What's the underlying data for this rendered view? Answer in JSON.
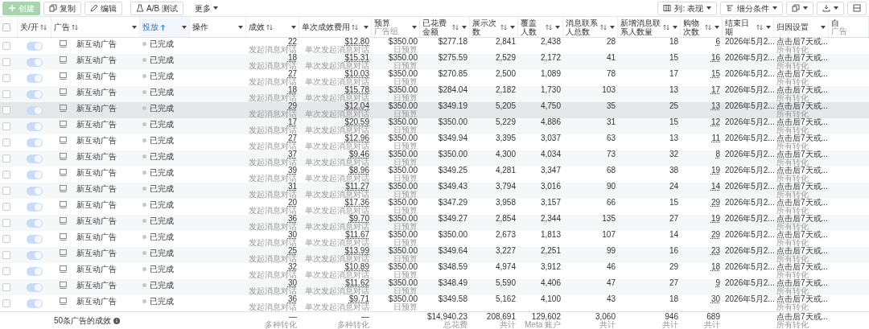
{
  "toolbar": {
    "left": [
      {
        "kind": "create",
        "label": "创建",
        "disabled": true
      },
      {
        "kind": "copy",
        "label": "复制"
      },
      {
        "kind": "edit",
        "label": "编辑"
      },
      {
        "kind": "ab",
        "label": "A/B 测试"
      },
      {
        "kind": "more",
        "label": "更多"
      }
    ],
    "right": [
      {
        "kind": "columns",
        "label": "列: 表现"
      },
      {
        "kind": "breakdown",
        "label": "细分条件"
      },
      {
        "kind": "copy"
      },
      {
        "kind": "export"
      },
      {
        "kind": "report"
      }
    ]
  },
  "select_all": {
    "checked": false
  },
  "columns": [
    {
      "label": "关/开",
      "sortable": true,
      "sorted": false,
      "dropdown": false
    },
    {
      "label": "广告",
      "sortable": true,
      "sorted": false,
      "dropdown": true
    },
    {
      "label": "投放",
      "sortable": true,
      "sorted": true,
      "dropdown": true
    },
    {
      "label": "操作",
      "sortable": false,
      "sorted": false,
      "dropdown": true
    },
    {
      "label": "成效",
      "sortable": true,
      "sorted": false,
      "dropdown": true
    },
    {
      "label": "单次成效费用",
      "sortable": true,
      "sorted": false,
      "dropdown": true
    },
    {
      "label": "预算",
      "sub": "广告组",
      "sortable": false,
      "sorted": false,
      "dropdown": true
    },
    {
      "label": "已花费金额",
      "sortable": true,
      "sorted": false,
      "dropdown": true
    },
    {
      "label": "展示次数",
      "sortable": true,
      "sorted": false,
      "dropdown": true
    },
    {
      "label": "覆盖人数",
      "sortable": true,
      "sorted": false,
      "dropdown": true
    },
    {
      "label": "消息联系人总数",
      "sortable": true,
      "sorted": false,
      "dropdown": true
    },
    {
      "label": "新增消息联系人数量",
      "sortable": true,
      "sorted": false,
      "dropdown": true
    },
    {
      "label": "购物次数",
      "sortable": true,
      "sorted": false,
      "dropdown": true
    },
    {
      "label": "结束日期",
      "sortable": true,
      "sorted": false,
      "dropdown": true
    },
    {
      "label": "归因设置",
      "sortable": false,
      "sorted": false,
      "dropdown": true
    },
    {
      "label": "自",
      "sub": "广告",
      "sortable": false,
      "sorted": false,
      "dropdown": false
    }
  ],
  "rows": [
    {
      "on": true,
      "highlighted": false,
      "name": "新互动广告",
      "status": "已完成",
      "results": "22",
      "results_note": "发起消息对话",
      "cost": "$12.80",
      "cost_note": "单次发起消息对话",
      "budget": "$350.00",
      "budget_note": "日预算",
      "spent": "$277.18",
      "impressions": "2,841",
      "reach": "2,438",
      "contacts": "28",
      "new_contacts": "18",
      "purchases": "6",
      "end_date": "2026年5月2...",
      "attribution": "点击后7天或...",
      "attribution_note": "所有转化"
    },
    {
      "on": true,
      "highlighted": false,
      "name": "新互动广告",
      "status": "已完成",
      "results": "18",
      "results_note": "发起消息对话",
      "cost": "$15.31",
      "cost_note": "单次发起消息对话",
      "budget": "$350.00",
      "budget_note": "日预算",
      "spent": "$275.59",
      "impressions": "2,529",
      "reach": "2,172",
      "contacts": "41",
      "new_contacts": "15",
      "purchases": "16",
      "end_date": "2026年5月2...",
      "attribution": "点击后7天或...",
      "attribution_note": "所有转化"
    },
    {
      "on": true,
      "highlighted": false,
      "name": "新互动广告",
      "status": "已完成",
      "results": "27",
      "results_note": "发起消息对话",
      "cost": "$10.03",
      "cost_note": "单次发起消息对话",
      "budget": "$350.00",
      "budget_note": "日预算",
      "spent": "$270.85",
      "impressions": "2,500",
      "reach": "1,089",
      "contacts": "78",
      "new_contacts": "17",
      "purchases": "15",
      "end_date": "2026年5月2...",
      "attribution": "点击后7天或...",
      "attribution_note": "所有转化"
    },
    {
      "on": true,
      "highlighted": false,
      "name": "新互动广告",
      "status": "已完成",
      "results": "18",
      "results_note": "发起消息对话",
      "cost": "$15.78",
      "cost_note": "单次发起消息对话",
      "budget": "$350.00",
      "budget_note": "日预算",
      "spent": "$284.04",
      "impressions": "2,182",
      "reach": "1,730",
      "contacts": "103",
      "new_contacts": "13",
      "purchases": "17",
      "end_date": "2026年5月2...",
      "attribution": "点击后7天或...",
      "attribution_note": "所有转化"
    },
    {
      "on": true,
      "highlighted": true,
      "name": "新互动广告",
      "status": "已完成",
      "results": "29",
      "results_note": "发起消息对话",
      "cost": "$12.04",
      "cost_note": "单次发起消息对话",
      "budget": "$350.00",
      "budget_note": "日预算",
      "spent": "$349.19",
      "impressions": "5,205",
      "reach": "4,750",
      "contacts": "35",
      "new_contacts": "25",
      "purchases": "13",
      "end_date": "2026年5月2...",
      "attribution": "点击后7天或...",
      "attribution_note": "所有转化"
    },
    {
      "on": true,
      "highlighted": false,
      "name": "新互动广告",
      "status": "已完成",
      "results": "17",
      "results_note": "发起消息对话",
      "cost": "$20.59",
      "cost_note": "单次发起消息对话",
      "budget": "$350.00",
      "budget_note": "日预算",
      "spent": "$350.00",
      "impressions": "5,229",
      "reach": "4,886",
      "contacts": "31",
      "new_contacts": "15",
      "purchases": "12",
      "end_date": "2026年5月2...",
      "attribution": "点击后7天或...",
      "attribution_note": "所有转化"
    },
    {
      "on": true,
      "highlighted": false,
      "name": "新互动广告",
      "status": "已完成",
      "results": "27",
      "results_note": "发起消息对话",
      "cost": "$12.96",
      "cost_note": "单次发起消息对话",
      "budget": "$350.00",
      "budget_note": "日预算",
      "spent": "$349.94",
      "impressions": "3,395",
      "reach": "3,037",
      "contacts": "63",
      "new_contacts": "13",
      "purchases": "11",
      "end_date": "2026年5月2...",
      "attribution": "点击后7天或...",
      "attribution_note": "所有转化"
    },
    {
      "on": true,
      "highlighted": false,
      "name": "新互动广告",
      "status": "已完成",
      "results": "37",
      "results_note": "发起消息对话",
      "cost": "$9.46",
      "cost_note": "单次发起消息对话",
      "budget": "$350.00",
      "budget_note": "日预算",
      "spent": "$350.00",
      "impressions": "4,300",
      "reach": "4,034",
      "contacts": "73",
      "new_contacts": "32",
      "purchases": "8",
      "end_date": "2026年5月2...",
      "attribution": "点击后7天或...",
      "attribution_note": "所有转化"
    },
    {
      "on": true,
      "highlighted": false,
      "name": "新互动广告",
      "status": "已完成",
      "results": "39",
      "results_note": "发起消息对话",
      "cost": "$8.96",
      "cost_note": "单次发起消息对话",
      "budget": "$350.00",
      "budget_note": "日预算",
      "spent": "$349.25",
      "impressions": "4,281",
      "reach": "3,347",
      "contacts": "68",
      "new_contacts": "38",
      "purchases": "19",
      "end_date": "2026年5月2...",
      "attribution": "点击后7天或...",
      "attribution_note": "所有转化"
    },
    {
      "on": true,
      "highlighted": false,
      "name": "新互动广告",
      "status": "已完成",
      "results": "31",
      "results_note": "发起消息对话",
      "cost": "$11.27",
      "cost_note": "单次发起消息对话",
      "budget": "$350.00",
      "budget_note": "日预算",
      "spent": "$349.43",
      "impressions": "3,794",
      "reach": "3,016",
      "contacts": "90",
      "new_contacts": "24",
      "purchases": "14",
      "end_date": "2026年5月2...",
      "attribution": "点击后7天或...",
      "attribution_note": "所有转化"
    },
    {
      "on": true,
      "highlighted": false,
      "name": "新互动广告",
      "status": "已完成",
      "results": "20",
      "results_note": "发起消息对话",
      "cost": "$17.36",
      "cost_note": "单次发起消息对话",
      "budget": "$350.00",
      "budget_note": "日预算",
      "spent": "$347.29",
      "impressions": "3,958",
      "reach": "3,157",
      "contacts": "66",
      "new_contacts": "15",
      "purchases": "29",
      "end_date": "2026年5月2...",
      "attribution": "点击后7天或...",
      "attribution_note": "所有转化"
    },
    {
      "on": true,
      "highlighted": false,
      "name": "新互动广告",
      "status": "已完成",
      "results": "36",
      "results_note": "发起消息对话",
      "cost": "$9.70",
      "cost_note": "单次发起消息对话",
      "budget": "$350.00",
      "budget_note": "日预算",
      "spent": "$349.27",
      "impressions": "2,854",
      "reach": "2,344",
      "contacts": "135",
      "new_contacts": "27",
      "purchases": "19",
      "end_date": "2026年5月2...",
      "attribution": "点击后7天或...",
      "attribution_note": "所有转化"
    },
    {
      "on": true,
      "highlighted": false,
      "name": "新互动广告",
      "status": "已完成",
      "results": "30",
      "results_note": "发起消息对话",
      "cost": "$11.67",
      "cost_note": "单次发起消息对话",
      "budget": "$350.00",
      "budget_note": "日预算",
      "spent": "$350.00",
      "impressions": "2,673",
      "reach": "1,813",
      "contacts": "107",
      "new_contacts": "14",
      "purchases": "29",
      "end_date": "2026年5月2...",
      "attribution": "点击后7天或...",
      "attribution_note": "所有转化"
    },
    {
      "on": true,
      "highlighted": false,
      "name": "新互动广告",
      "status": "已完成",
      "results": "25",
      "results_note": "发起消息对话",
      "cost": "$13.99",
      "cost_note": "单次发起消息对话",
      "budget": "$350.00",
      "budget_note": "日预算",
      "spent": "$349.64",
      "impressions": "3,227",
      "reach": "2,251",
      "contacts": "99",
      "new_contacts": "16",
      "purchases": "23",
      "end_date": "2026年5月2...",
      "attribution": "点击后7天或...",
      "attribution_note": "所有转化"
    },
    {
      "on": true,
      "highlighted": false,
      "name": "新互动广告",
      "status": "已完成",
      "results": "32",
      "results_note": "发起消息对话",
      "cost": "$10.89",
      "cost_note": "单次发起消息对话",
      "budget": "$350.00",
      "budget_note": "日预算",
      "spent": "$348.59",
      "impressions": "4,974",
      "reach": "3,912",
      "contacts": "46",
      "new_contacts": "29",
      "purchases": "18",
      "end_date": "2026年5月2...",
      "attribution": "点击后7天或...",
      "attribution_note": "所有转化"
    },
    {
      "on": true,
      "highlighted": false,
      "name": "新互动广告",
      "status": "已完成",
      "results": "30",
      "results_note": "发起消息对话",
      "cost": "$11.62",
      "cost_note": "单次发起消息对话",
      "budget": "$350.00",
      "budget_note": "日预算",
      "spent": "$348.49",
      "impressions": "5,590",
      "reach": "4,406",
      "contacts": "47",
      "new_contacts": "27",
      "purchases": "9",
      "end_date": "2026年5月2...",
      "attribution": "点击后7天或...",
      "attribution_note": "所有转化"
    },
    {
      "on": true,
      "highlighted": false,
      "name": "新互动广告",
      "status": "已完成",
      "results": "36",
      "results_note": "发起消息对话",
      "cost": "$9.71",
      "cost_note": "单次发起消息对话",
      "budget": "$350.00",
      "budget_note": "日预算",
      "spent": "$349.58",
      "impressions": "5,162",
      "reach": "4,100",
      "contacts": "43",
      "new_contacts": "18",
      "purchases": "30",
      "end_date": "2026年5月2...",
      "attribution": "点击后7天或...",
      "attribution_note": "所有转化"
    }
  ],
  "footer": {
    "summary": "50条广告的成效",
    "cells": {
      "results": {
        "value": "—",
        "note": "多种转化"
      },
      "cost": {
        "value": "—",
        "note": "多种转化"
      },
      "spent": {
        "value": "$14,940.23",
        "note": "总花费"
      },
      "impressions": {
        "value": "208,691",
        "note": "共计"
      },
      "reach": {
        "value": "129,602",
        "note": "Meta 账户"
      },
      "contacts": {
        "value": "3,060",
        "note": "共计"
      },
      "new_contacts": {
        "value": "946",
        "note": "共计"
      },
      "purchases": {
        "value": "689",
        "note": "共计"
      },
      "attribution": {
        "value": "点击后7天或...",
        "note": "所有转化"
      }
    }
  }
}
